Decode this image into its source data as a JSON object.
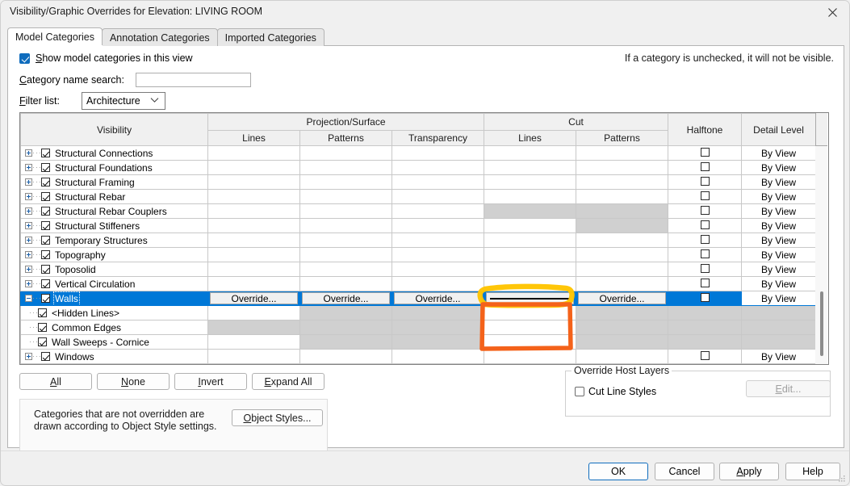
{
  "window": {
    "title": "Visibility/Graphic Overrides for Elevation: LIVING ROOM",
    "close_icon": "close-icon"
  },
  "tabs": [
    {
      "label": "Model Categories",
      "active": true
    },
    {
      "label": "Annotation Categories",
      "active": false
    },
    {
      "label": "Imported Categories",
      "active": false
    }
  ],
  "options": {
    "show_model_categories_label": "Show model categories in this view",
    "show_model_categories_checked": true,
    "hint": "If a category is unchecked, it will not be visible.",
    "search_label": "Category name search:",
    "search_value": "",
    "search_placeholder": "",
    "filter_label": "Filter list:",
    "filter_value": "Architecture",
    "filter_chevron_icon": "chevron-down-icon"
  },
  "table": {
    "group_headers": [
      {
        "label": "Visibility",
        "span": 1
      },
      {
        "label": "Projection/Surface",
        "span": 3
      },
      {
        "label": "Cut",
        "span": 2
      },
      {
        "label": "Halftone",
        "span": 1
      },
      {
        "label": "Detail Level",
        "span": 1
      }
    ],
    "sub_headers": [
      "Lines",
      "Patterns",
      "Transparency",
      "Lines",
      "Patterns"
    ],
    "rows": [
      {
        "name": "Structural Connections",
        "level": 0,
        "expander": "plus",
        "checked": true,
        "proj_lines": "",
        "proj_patterns": "",
        "proj_transparency": "",
        "cut_lines": "",
        "cut_patterns": "",
        "halftone": false,
        "detail": "By View",
        "selected": false,
        "disabled": {
          "proj_lines": false,
          "proj_patterns": false,
          "proj_transparency": false,
          "cut_lines": false,
          "cut_patterns": false
        }
      },
      {
        "name": "Structural Foundations",
        "level": 0,
        "expander": "plus",
        "checked": true,
        "proj_lines": "",
        "proj_patterns": "",
        "proj_transparency": "",
        "cut_lines": "",
        "cut_patterns": "",
        "halftone": false,
        "detail": "By View",
        "selected": false,
        "disabled": {
          "proj_lines": false,
          "proj_patterns": false,
          "proj_transparency": false,
          "cut_lines": false,
          "cut_patterns": false
        }
      },
      {
        "name": "Structural Framing",
        "level": 0,
        "expander": "plus",
        "checked": true,
        "proj_lines": "",
        "proj_patterns": "",
        "proj_transparency": "",
        "cut_lines": "",
        "cut_patterns": "",
        "halftone": false,
        "detail": "By View",
        "selected": false,
        "disabled": {
          "proj_lines": false,
          "proj_patterns": false,
          "proj_transparency": false,
          "cut_lines": false,
          "cut_patterns": false
        }
      },
      {
        "name": "Structural Rebar",
        "level": 0,
        "expander": "plus",
        "checked": true,
        "proj_lines": "",
        "proj_patterns": "",
        "proj_transparency": "",
        "cut_lines": "",
        "cut_patterns": "",
        "halftone": false,
        "detail": "By View",
        "selected": false,
        "disabled": {
          "proj_lines": false,
          "proj_patterns": false,
          "proj_transparency": false,
          "cut_lines": false,
          "cut_patterns": false
        }
      },
      {
        "name": "Structural Rebar Couplers",
        "level": 0,
        "expander": "plus",
        "checked": true,
        "proj_lines": "",
        "proj_patterns": "",
        "proj_transparency": "",
        "cut_lines": "",
        "cut_patterns": "",
        "halftone": false,
        "detail": "By View",
        "selected": false,
        "disabled": {
          "proj_lines": false,
          "proj_patterns": false,
          "proj_transparency": false,
          "cut_lines": true,
          "cut_patterns": true
        }
      },
      {
        "name": "Structural Stiffeners",
        "level": 0,
        "expander": "plus",
        "checked": true,
        "proj_lines": "",
        "proj_patterns": "",
        "proj_transparency": "",
        "cut_lines": "",
        "cut_patterns": "",
        "halftone": false,
        "detail": "By View",
        "selected": false,
        "disabled": {
          "proj_lines": false,
          "proj_patterns": false,
          "proj_transparency": false,
          "cut_lines": false,
          "cut_patterns": true
        }
      },
      {
        "name": "Temporary Structures",
        "level": 0,
        "expander": "plus",
        "checked": true,
        "proj_lines": "",
        "proj_patterns": "",
        "proj_transparency": "",
        "cut_lines": "",
        "cut_patterns": "",
        "halftone": false,
        "detail": "By View",
        "selected": false,
        "disabled": {
          "proj_lines": false,
          "proj_patterns": false,
          "proj_transparency": false,
          "cut_lines": false,
          "cut_patterns": false
        }
      },
      {
        "name": "Topography",
        "level": 0,
        "expander": "plus",
        "checked": true,
        "proj_lines": "",
        "proj_patterns": "",
        "proj_transparency": "",
        "cut_lines": "",
        "cut_patterns": "",
        "halftone": false,
        "detail": "By View",
        "selected": false,
        "disabled": {
          "proj_lines": false,
          "proj_patterns": false,
          "proj_transparency": false,
          "cut_lines": false,
          "cut_patterns": false
        }
      },
      {
        "name": "Toposolid",
        "level": 0,
        "expander": "plus",
        "checked": true,
        "proj_lines": "",
        "proj_patterns": "",
        "proj_transparency": "",
        "cut_lines": "",
        "cut_patterns": "",
        "halftone": false,
        "detail": "By View",
        "selected": false,
        "disabled": {
          "proj_lines": false,
          "proj_patterns": false,
          "proj_transparency": false,
          "cut_lines": false,
          "cut_patterns": false
        }
      },
      {
        "name": "Vertical Circulation",
        "level": 0,
        "expander": "plus",
        "checked": true,
        "proj_lines": "",
        "proj_patterns": "",
        "proj_transparency": "",
        "cut_lines": "",
        "cut_patterns": "",
        "halftone": false,
        "detail": "By View",
        "selected": false,
        "disabled": {
          "proj_lines": false,
          "proj_patterns": false,
          "proj_transparency": false,
          "cut_lines": false,
          "cut_patterns": false
        }
      },
      {
        "name": "Walls",
        "level": 0,
        "expander": "minus",
        "checked": true,
        "proj_lines": "Override...",
        "proj_patterns": "Override...",
        "proj_transparency": "Override...",
        "cut_lines": "line-sample",
        "cut_patterns": "Override...",
        "halftone": false,
        "detail": "By View",
        "selected": true,
        "disabled": {
          "proj_lines": false,
          "proj_patterns": false,
          "proj_transparency": false,
          "cut_lines": false,
          "cut_patterns": false
        }
      },
      {
        "name": "<Hidden Lines>",
        "level": 1,
        "expander": "none",
        "checked": true,
        "proj_lines": "",
        "proj_patterns": "",
        "proj_transparency": "",
        "cut_lines": "",
        "cut_patterns": "",
        "halftone": null,
        "detail": "",
        "selected": false,
        "disabled": {
          "proj_lines": false,
          "proj_patterns": true,
          "proj_transparency": true,
          "cut_lines": false,
          "cut_patterns": true,
          "halftone": true,
          "detail": true
        }
      },
      {
        "name": "Common Edges",
        "level": 1,
        "expander": "none",
        "checked": true,
        "proj_lines": "",
        "proj_patterns": "",
        "proj_transparency": "",
        "cut_lines": "",
        "cut_patterns": "",
        "halftone": null,
        "detail": "",
        "selected": false,
        "disabled": {
          "proj_lines": true,
          "proj_patterns": true,
          "proj_transparency": true,
          "cut_lines": false,
          "cut_patterns": true,
          "halftone": true,
          "detail": true
        }
      },
      {
        "name": "Wall Sweeps - Cornice",
        "level": 1,
        "expander": "none",
        "checked": true,
        "proj_lines": "",
        "proj_patterns": "",
        "proj_transparency": "",
        "cut_lines": "",
        "cut_patterns": "",
        "halftone": null,
        "detail": "",
        "selected": false,
        "disabled": {
          "proj_lines": false,
          "proj_patterns": true,
          "proj_transparency": true,
          "cut_lines": false,
          "cut_patterns": true,
          "halftone": true,
          "detail": true
        }
      },
      {
        "name": "Windows",
        "level": 0,
        "expander": "plus",
        "checked": true,
        "proj_lines": "",
        "proj_patterns": "",
        "proj_transparency": "",
        "cut_lines": "",
        "cut_patterns": "",
        "halftone": false,
        "detail": "By View",
        "selected": false,
        "disabled": {
          "proj_lines": false,
          "proj_patterns": false,
          "proj_transparency": false,
          "cut_lines": false,
          "cut_patterns": false
        }
      }
    ]
  },
  "selection_buttons": {
    "all": "All",
    "none": "None",
    "invert": "Invert",
    "expand_all": "Expand All"
  },
  "note": {
    "text": "Categories that are not overridden are drawn according to Object Style settings.",
    "object_styles_button": "Object Styles..."
  },
  "override_host_layers": {
    "legend": "Override Host Layers",
    "cut_line_styles_label": "Cut Line Styles",
    "cut_line_styles_checked": false,
    "edit_button": "Edit...",
    "edit_disabled": true
  },
  "footer": {
    "ok": "OK",
    "cancel": "Cancel",
    "apply": "Apply",
    "help": "Help"
  },
  "annotations": {
    "highlight_color": "#ffc400",
    "box_color": "#f4621a",
    "highlight_target": "cut-lines-cell-walls",
    "box_target": "cut-lines-cells-wall-subcategories"
  }
}
